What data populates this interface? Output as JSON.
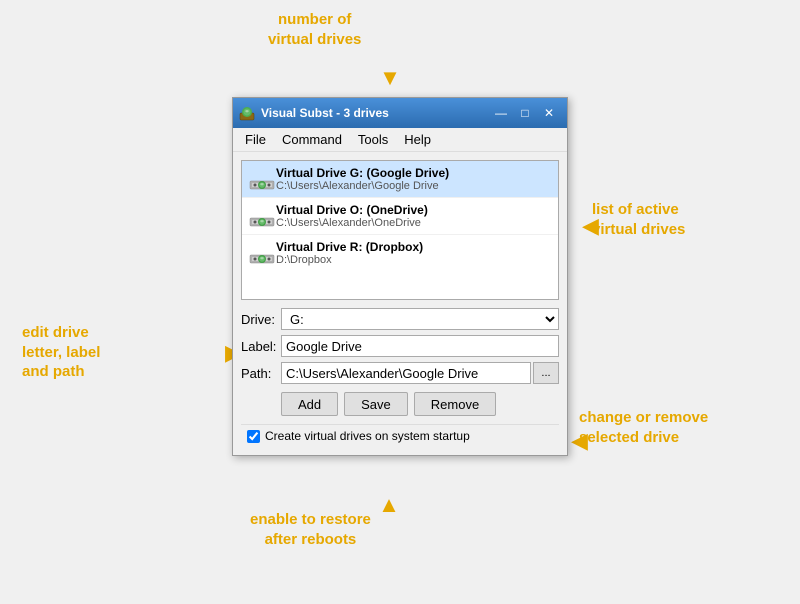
{
  "annotations": {
    "num_drives": {
      "text": "number of\nvirtual drives",
      "style": "top:10px; left:270px;"
    },
    "list_drives": {
      "text": "list of active\nvirtual drives",
      "style": "top:200px; left:590px;"
    },
    "edit_drive": {
      "text": "edit drive\nletter, label\nand path",
      "style": "top:330px; left:30px;"
    },
    "change_remove": {
      "text": "change or remove\nselected drive",
      "style": "top:415px; left:580px;"
    },
    "enable_restore": {
      "text": "enable to restore\nafter reboots",
      "style": "top:510px; left:260px;"
    }
  },
  "window": {
    "title": "Visual Subst - 3 drives",
    "min_btn": "—",
    "max_btn": "□",
    "close_btn": "✕"
  },
  "menu": {
    "items": [
      "File",
      "Command",
      "Tools",
      "Help"
    ]
  },
  "drives": [
    {
      "name": "Virtual Drive G: (Google Drive)",
      "path": "C:\\Users\\Alexander\\Google Drive",
      "selected": true
    },
    {
      "name": "Virtual Drive O: (OneDrive)",
      "path": "C:\\Users\\Alexander\\OneDrive",
      "selected": false
    },
    {
      "name": "Virtual Drive R: (Dropbox)",
      "path": "D:\\Dropbox",
      "selected": false
    }
  ],
  "fields": {
    "drive_label": "Drive:",
    "drive_value": "G:",
    "label_label": "Label:",
    "label_value": "Google Drive",
    "path_label": "Path:",
    "path_value": "C:\\Users\\Alexander\\Google Drive",
    "browse_label": "..."
  },
  "buttons": {
    "add": "Add",
    "save": "Save",
    "remove": "Remove"
  },
  "checkbox": {
    "label": "Create virtual drives on system startup",
    "checked": true
  }
}
